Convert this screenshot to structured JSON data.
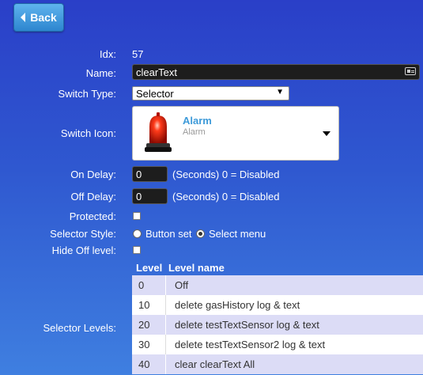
{
  "back_label": "Back",
  "form": {
    "idx_label": "Idx:",
    "idx_value": "57",
    "name_label": "Name:",
    "name_value": "clearText",
    "switch_type_label": "Switch Type:",
    "switch_type_value": "Selector",
    "switch_icon_label": "Switch Icon:",
    "icon_title": "Alarm",
    "icon_subtitle": "Alarm",
    "on_delay_label": "On Delay:",
    "on_delay_value": "0",
    "on_delay_hint": "(Seconds) 0 = Disabled",
    "off_delay_label": "Off Delay:",
    "off_delay_value": "0",
    "off_delay_hint": "(Seconds) 0 = Disabled",
    "protected_label": "Protected:",
    "protected_checked": false,
    "selector_style_label": "Selector Style:",
    "style_option_buttonset": "Button set",
    "style_option_selectmenu": "Select menu",
    "selected_style": "Select menu",
    "hide_off_label": "Hide Off level:",
    "hide_off_checked": false,
    "selector_levels_label": "Selector Levels:"
  },
  "levels": {
    "header_level": "Level",
    "header_name": "Level name",
    "rows": [
      {
        "level": "0",
        "name": "Off"
      },
      {
        "level": "10",
        "name": "delete gasHistory log & text"
      },
      {
        "level": "20",
        "name": "delete testTextSensor log & text"
      },
      {
        "level": "30",
        "name": "delete testTextSensor2 log & text"
      },
      {
        "level": "40",
        "name": "clear clearText All"
      }
    ],
    "row_colors": [
      "#dcdcf6",
      "#ffffff"
    ]
  },
  "colors": {
    "icon_title": "#3d9ad9",
    "back_button": "#2d86cf"
  }
}
